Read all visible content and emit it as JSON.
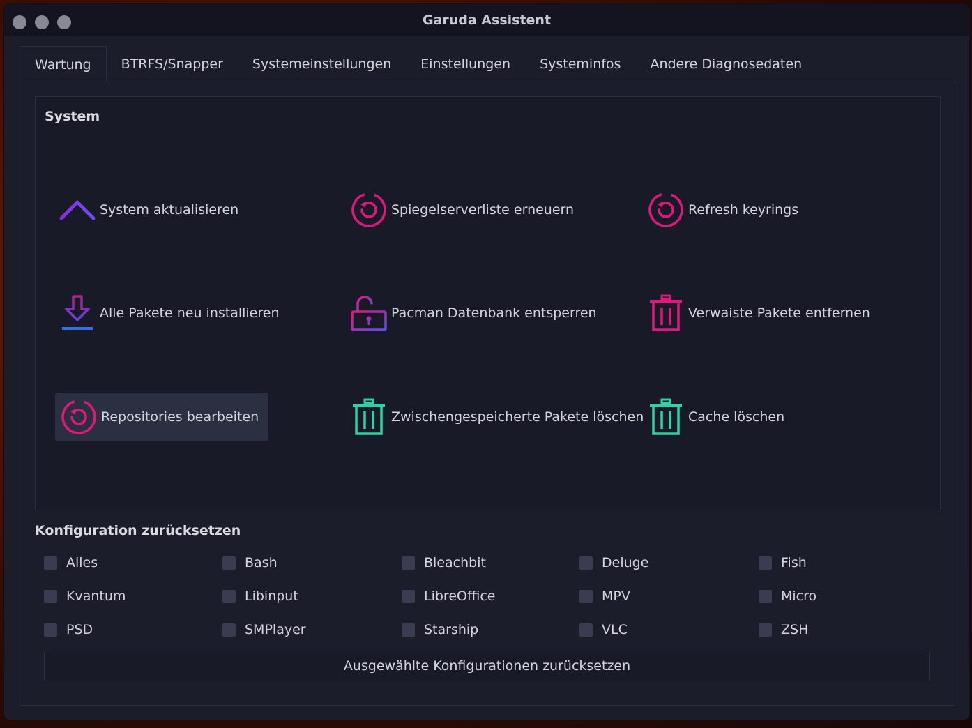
{
  "window": {
    "title": "Garuda Assistent"
  },
  "tabs": [
    {
      "label": "Wartung"
    },
    {
      "label": "BTRFS/Snapper"
    },
    {
      "label": "Systemeinstellungen"
    },
    {
      "label": "Einstellungen"
    },
    {
      "label": "Systeminfos"
    },
    {
      "label": "Andere Diagnosedaten"
    }
  ],
  "active_tab": "Wartung",
  "system": {
    "title": "System",
    "actions": [
      {
        "label": "System aktualisieren",
        "icon": "chevron-up-icon"
      },
      {
        "label": "Spiegelserverliste erneuern",
        "icon": "refresh-icon"
      },
      {
        "label": "Refresh keyrings",
        "icon": "refresh-icon"
      },
      {
        "label": "Alle Pakete neu installieren",
        "icon": "download-icon"
      },
      {
        "label": "Pacman Datenbank entsperren",
        "icon": "unlock-icon"
      },
      {
        "label": "Verwaiste Pakete entfernen",
        "icon": "trash-icon"
      },
      {
        "label": "Repositories bearbeiten",
        "icon": "refresh-icon"
      },
      {
        "label": "Zwischengespeicherte Pakete löschen",
        "icon": "trash-icon"
      },
      {
        "label": "Cache löschen",
        "icon": "trash-icon"
      }
    ]
  },
  "reset": {
    "title": "Konfiguration zurücksetzen",
    "options": [
      "Alles",
      "Bash",
      "Bleachbit",
      "Deluge",
      "Fish",
      "Kvantum",
      "Libinput",
      "LibreOffice",
      "MPV",
      "Micro",
      "PSD",
      "SMPlayer",
      "Starship",
      "VLC",
      "ZSH"
    ],
    "button_label": "Ausgewählte Konfigurationen zurücksetzen"
  },
  "colors": {
    "magenta": "#e0187e",
    "purple": "#7b3fe4",
    "teal": "#2fd3a0",
    "background": "#1b1d2b"
  }
}
